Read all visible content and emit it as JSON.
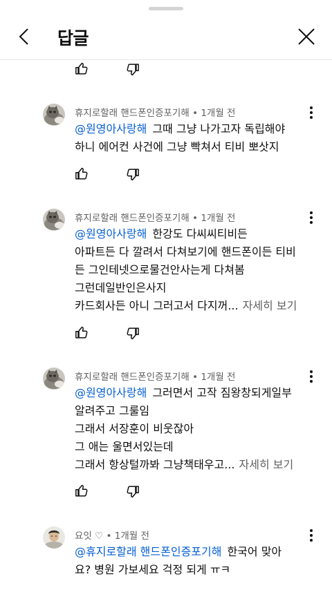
{
  "header": {
    "title": "답글"
  },
  "comments": [
    {
      "author": "휴지로할래 핸드폰인증포기해",
      "time": "1개월 전",
      "mention": "@원영아사랑해",
      "lines": [
        "그때 그냥 나가고자 독립해야",
        "하니 에어컨 사건에 그냥 빡쳐서 티비 뽀삿지"
      ]
    },
    {
      "author": "휴지로할래 핸드폰인증포기해",
      "time": "1개월 전",
      "mention": "@원영아사랑해",
      "lines": [
        "한강도 다씨씨티비든",
        "아파트든 다 깔려서 다쳐보기에 핸드폰이든 티비",
        "든 그인테넷으로물건안사는게 다쳐봄",
        "그런데일반인은사지",
        "카드회사든 아니 그러고서 다지꺼..."
      ],
      "more": "자세히 보기"
    },
    {
      "author": "휴지로할래 핸드폰인증포기해",
      "time": "1개월 전",
      "mention": "@원영아사랑해",
      "lines": [
        "그러면서 고작 짐왕창되게일부",
        "알려주고 그룰임",
        "그래서 서장훈이 비웃잖아",
        "그 애는 울면서있는데",
        "그래서 항상털까봐 그냥책태우고..."
      ],
      "more": "자세히 보기"
    },
    {
      "author": "요잇 ♡",
      "time": "1개월 전",
      "mention": "@휴지로할래 핸드폰인증포기해",
      "lines": [
        "한국어 맞아",
        "요? 병원 가보세요 걱정 되게 ㅠㅋ"
      ]
    }
  ],
  "separator": "•",
  "icons": {
    "back": "chevron-left-icon",
    "close": "close-icon",
    "like": "thumbs-up-icon",
    "dislike": "thumbs-down-icon",
    "menu": "more-vertical-icon"
  },
  "colors": {
    "mention": "#065fd4",
    "meta": "#606060",
    "text": "#0f0f0f"
  }
}
